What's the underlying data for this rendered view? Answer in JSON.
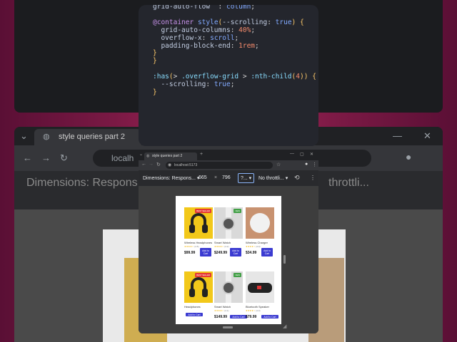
{
  "code": {
    "lines": [
      {
        "parts": [
          [
            "pr",
            "grid-auto-flow"
          ],
          [
            "",
            "  : "
          ],
          [
            "va",
            "column"
          ],
          [
            "",
            ";"
          ]
        ]
      },
      {
        "parts": [
          [
            "",
            ""
          ]
        ]
      },
      {
        "parts": [
          [
            "kw",
            "@container"
          ],
          [
            "",
            " "
          ],
          [
            "va",
            "style"
          ],
          [
            "br",
            "("
          ],
          [
            "pr",
            "--scrolling"
          ],
          [
            "",
            ": "
          ],
          [
            "va",
            "true"
          ],
          [
            "br",
            ")"
          ],
          [
            "",
            " "
          ],
          [
            "br",
            "{"
          ]
        ]
      },
      {
        "parts": [
          [
            "",
            "  "
          ],
          [
            "pr",
            "grid-auto-columns"
          ],
          [
            "",
            ": "
          ],
          [
            "nu",
            "40%"
          ],
          [
            "",
            ";"
          ]
        ]
      },
      {
        "parts": [
          [
            "",
            "  "
          ],
          [
            "pr",
            "overflow-x"
          ],
          [
            "",
            ": "
          ],
          [
            "va",
            "scroll"
          ],
          [
            "",
            ";"
          ]
        ]
      },
      {
        "parts": [
          [
            "",
            "  "
          ],
          [
            "pr",
            "padding-block-end"
          ],
          [
            "",
            ": "
          ],
          [
            "nu",
            "1rem"
          ],
          [
            "",
            ";"
          ]
        ]
      },
      {
        "parts": [
          [
            "br",
            "}"
          ]
        ]
      },
      {
        "parts": [
          [
            "br",
            "}"
          ]
        ]
      },
      {
        "parts": [
          [
            "",
            ""
          ]
        ]
      },
      {
        "parts": [
          [
            "sl",
            ":has"
          ],
          [
            "br",
            "("
          ],
          [
            "",
            ">"
          ],
          [
            "",
            " "
          ],
          [
            "sl",
            ".overflow-grid"
          ],
          [
            "",
            ""
          ],
          [
            "",
            " > "
          ],
          [
            "sl",
            ":nth-child"
          ],
          [
            "br",
            "("
          ],
          [
            "nu",
            "4"
          ],
          [
            "br",
            "))"
          ],
          [
            "",
            " "
          ],
          [
            "br",
            "{"
          ]
        ]
      },
      {
        "parts": [
          [
            "",
            "  "
          ],
          [
            "pr",
            "--scrolling"
          ],
          [
            "",
            ": "
          ],
          [
            "va",
            "true"
          ],
          [
            "",
            ";"
          ]
        ]
      },
      {
        "parts": [
          [
            "br",
            "}"
          ]
        ]
      }
    ]
  },
  "bg_browser": {
    "tab_title": "style queries part 2",
    "url": "localh",
    "dimensions_text": "Dimensions: Respons...",
    "throttle_text": "throttli..."
  },
  "front_browser": {
    "tab_title": "style queries part 2",
    "url": "localhost:5173",
    "dimensions_label": "Dimensions: Respons...",
    "width": "665",
    "times": "×",
    "height": "796",
    "zoom": "?...",
    "throttle": "No throttli..."
  },
  "products": [
    {
      "name": "Wireless Headphones",
      "price": "$99.99",
      "stars": "★★★★☆",
      "rating": "(4.5)",
      "button": "Add to Cart",
      "badge": "BEST SELLER",
      "badge_color": "#e53935",
      "img": "yellow"
    },
    {
      "name": "Smart Watch",
      "price": "$249.99",
      "stars": "★★★★☆",
      "rating": "(4.2)",
      "button": "Add to Cart",
      "badge": "NEW",
      "badge_color": "#43a047",
      "img": "watch"
    },
    {
      "name": "Wireless Charger",
      "price": "$34.99",
      "stars": "★★★★☆",
      "rating": "(4.0)",
      "button": "Add to Cart",
      "badge": "",
      "badge_color": "",
      "img": "charger"
    },
    {
      "name": "Headphones",
      "price": "",
      "stars": "",
      "rating": "",
      "button": "Add to Cart",
      "badge": "BEST SELLER",
      "badge_color": "#e53935",
      "img": "yellow"
    },
    {
      "name": "Smart Watch",
      "price": "$149.99",
      "stars": "★★★★☆",
      "rating": "(4.1)",
      "button": "Add to Cart",
      "badge": "NEW",
      "badge_color": "#43a047",
      "img": "watch"
    },
    {
      "name": "Bluetooth Speaker",
      "price": "$79.99",
      "stars": "★★★★☆",
      "rating": "(4.3)",
      "button": "Add to Cart",
      "badge": "",
      "badge_color": "",
      "img": "speaker"
    }
  ]
}
